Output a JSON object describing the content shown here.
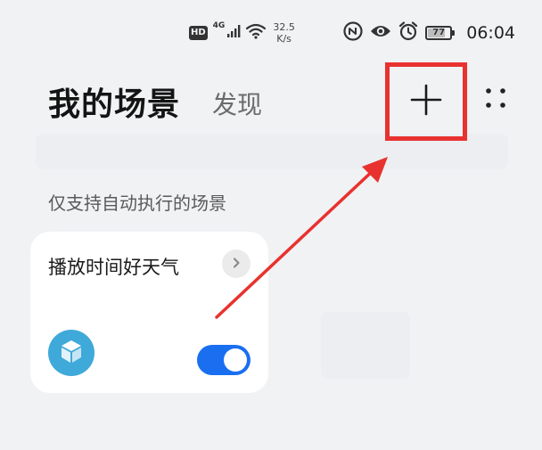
{
  "status_bar": {
    "hd_label": "HD",
    "network_label": "4G",
    "speed_value": "32.5",
    "speed_unit": "K/s",
    "battery_level": "77",
    "battery_fraction": 0.77,
    "time": "06:04",
    "icons": [
      "signal-bars-icon",
      "wifi-icon",
      "nfc-icon",
      "eye-icon",
      "alarm-icon",
      "battery-icon"
    ]
  },
  "header": {
    "title": "我的场景",
    "discover_tab": "发现",
    "add_icon": "plus-icon",
    "more_icon": "four-dots-icon"
  },
  "section": {
    "label": "仅支持自动执行的场景"
  },
  "scene_card": {
    "name": "播放时间好天气",
    "chevron_icon": "chevron-right-icon",
    "scene_icon": "cube-icon",
    "toggle_on": true
  },
  "colors": {
    "background": "#f1f2f4",
    "accent_blue": "#1a6ff0",
    "annotation_red": "#e8322f",
    "scene_icon_bg": "#3fa9d9"
  }
}
